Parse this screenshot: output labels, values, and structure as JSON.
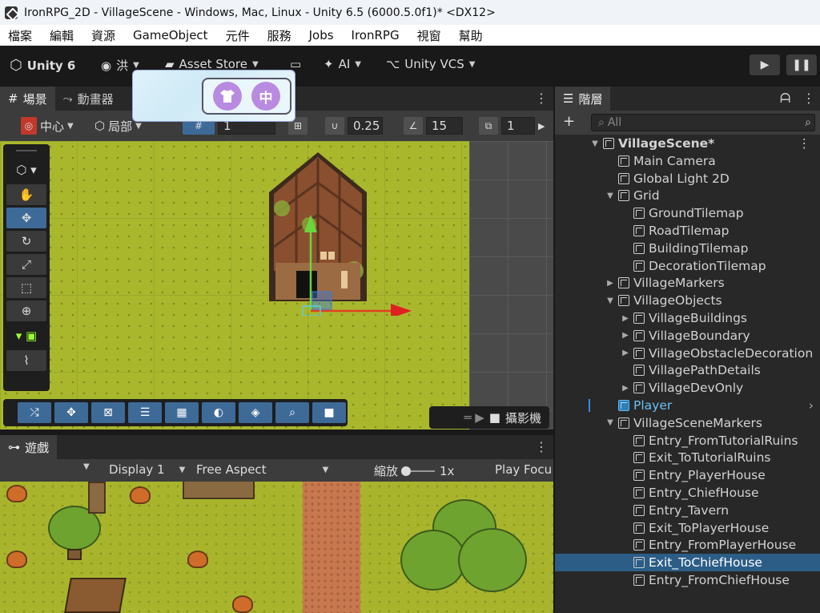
{
  "window": {
    "title": "IronRPG_2D - VillageScene - Windows, Mac, Linux - Unity 6.5 (6000.5.0f1)* <DX12>"
  },
  "menu": [
    "檔案",
    "編輯",
    "資源",
    "GameObject",
    "元件",
    "服務",
    "Jobs",
    "IronRPG",
    "視窗",
    "幫助"
  ],
  "toolbar": {
    "unity": "Unity 6",
    "account": "洪",
    "asset_store": "Asset Store",
    "ai": "AI",
    "vcs": "Unity VCS"
  },
  "scene_tabs": {
    "scene": "場景",
    "animator": "動畫器"
  },
  "scene_toolbar": {
    "pivot": "中心",
    "space": "局部",
    "grid_val": "1",
    "snap_val": "0.25",
    "angle_val": "15",
    "scale_val": "1"
  },
  "popup": {
    "shirt_icon": "tshirt-icon",
    "lang": "中"
  },
  "camera_label": "攝影機",
  "game_tab": "遊戲",
  "game_toolbar": {
    "display": "Display 1",
    "aspect": "Free Aspect",
    "zoom_label": "縮放",
    "zoom_value": "1x",
    "play_focus": "Play Focu"
  },
  "hierarchy": {
    "tab": "階層",
    "search_placeholder": "All",
    "items": [
      {
        "label": "VillageScene*",
        "level": 0,
        "arrow": "▼",
        "icon": "scene"
      },
      {
        "label": "Main Camera",
        "level": 1,
        "arrow": "",
        "icon": "cube"
      },
      {
        "label": "Global Light 2D",
        "level": 1,
        "arrow": "",
        "icon": "cube"
      },
      {
        "label": "Grid",
        "level": 1,
        "arrow": "▼",
        "icon": "cube"
      },
      {
        "label": "GroundTilemap",
        "level": 2,
        "arrow": "",
        "icon": "cube"
      },
      {
        "label": "RoadTilemap",
        "level": 2,
        "arrow": "",
        "icon": "cube"
      },
      {
        "label": "BuildingTilemap",
        "level": 2,
        "arrow": "",
        "icon": "cube"
      },
      {
        "label": "DecorationTilemap",
        "level": 2,
        "arrow": "",
        "icon": "cube"
      },
      {
        "label": "VillageMarkers",
        "level": 1,
        "arrow": "▶",
        "icon": "cube"
      },
      {
        "label": "VillageObjects",
        "level": 1,
        "arrow": "▼",
        "icon": "cube"
      },
      {
        "label": "VillageBuildings",
        "level": 2,
        "arrow": "▶",
        "icon": "cube"
      },
      {
        "label": "VillageBoundary",
        "level": 2,
        "arrow": "▶",
        "icon": "cube"
      },
      {
        "label": "VillageObstacleDecoration",
        "level": 2,
        "arrow": "▶",
        "icon": "cube"
      },
      {
        "label": "VillagePathDetails",
        "level": 2,
        "arrow": "",
        "icon": "cube"
      },
      {
        "label": "VillageDevOnly",
        "level": 2,
        "arrow": "▶",
        "icon": "cube"
      },
      {
        "label": "Player",
        "level": 1,
        "arrow": "",
        "icon": "prefab"
      },
      {
        "label": "VillageSceneMarkers",
        "level": 1,
        "arrow": "▼",
        "icon": "cube"
      },
      {
        "label": "Entry_FromTutorialRuins",
        "level": 2,
        "arrow": "",
        "icon": "cube"
      },
      {
        "label": "Exit_ToTutorialRuins",
        "level": 2,
        "arrow": "",
        "icon": "cube"
      },
      {
        "label": "Entry_PlayerHouse",
        "level": 2,
        "arrow": "",
        "icon": "cube"
      },
      {
        "label": "Entry_ChiefHouse",
        "level": 2,
        "arrow": "",
        "icon": "cube"
      },
      {
        "label": "Entry_Tavern",
        "level": 2,
        "arrow": "",
        "icon": "cube"
      },
      {
        "label": "Exit_ToPlayerHouse",
        "level": 2,
        "arrow": "",
        "icon": "cube"
      },
      {
        "label": "Entry_FromPlayerHouse",
        "level": 2,
        "arrow": "",
        "icon": "cube"
      },
      {
        "label": "Exit_ToChiefHouse",
        "level": 2,
        "arrow": "",
        "icon": "cube",
        "selected": true
      },
      {
        "label": "Entry_FromChiefHouse",
        "level": 2,
        "arrow": "",
        "icon": "cube"
      }
    ]
  }
}
